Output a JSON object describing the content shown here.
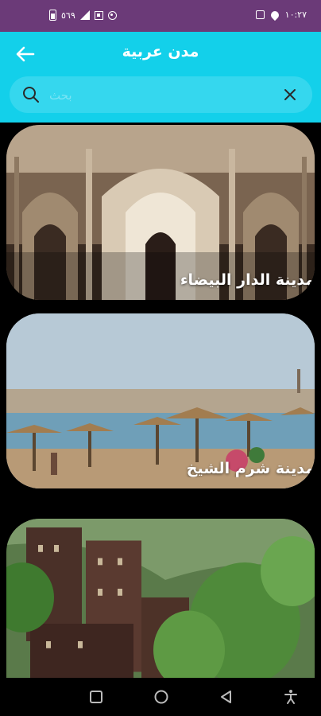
{
  "status_bar": {
    "time": "١٠:٢٧",
    "battery": "٥٦٩",
    "icons": [
      "battery-icon",
      "signal-icon",
      "qr-icon",
      "circle-icon",
      "image-icon",
      "location-icon"
    ]
  },
  "app_bar": {
    "title": "مدن عربية",
    "back_icon": "arrow-left-icon"
  },
  "search": {
    "placeholder": "بحث",
    "value": ""
  },
  "cities": [
    {
      "label": "مدينة الدار البيضاء"
    },
    {
      "label": "مدينة شرم الشيخ"
    },
    {
      "label": ""
    }
  ],
  "nav_bar": {
    "icons": [
      "recents-square-icon",
      "home-circle-icon",
      "back-triangle-icon",
      "accessibility-icon"
    ]
  },
  "colors": {
    "status_bar": "#6b3a78",
    "app_bar": "#13d0ea",
    "search_field": "#35d7ee",
    "background": "#000000"
  }
}
